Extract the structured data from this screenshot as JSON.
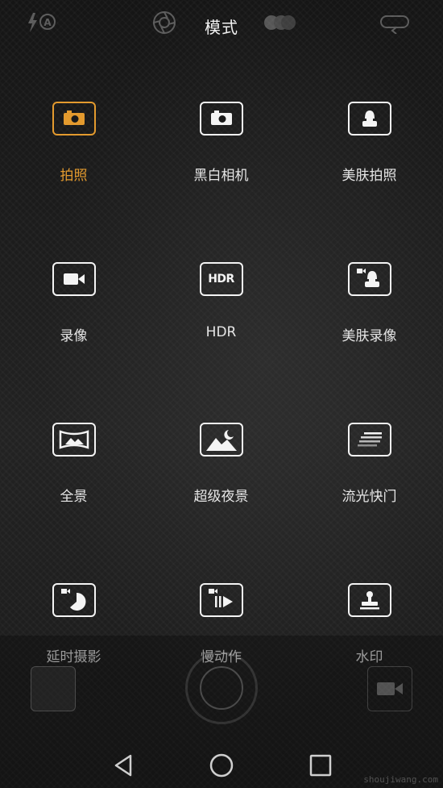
{
  "header": {
    "title": "模式"
  },
  "modes": [
    {
      "label": "拍照",
      "icon": "camera-icon",
      "active": true
    },
    {
      "label": "黑白相机",
      "icon": "camera-icon"
    },
    {
      "label": "美肤拍照",
      "icon": "portrait-icon"
    },
    {
      "label": "录像",
      "icon": "video-icon"
    },
    {
      "label": "HDR",
      "icon": "hdr-icon",
      "icon_text": "HDR"
    },
    {
      "label": "美肤录像",
      "icon": "portrait-video-icon"
    },
    {
      "label": "全景",
      "icon": "panorama-icon"
    },
    {
      "label": "超级夜景",
      "icon": "night-landscape-icon"
    },
    {
      "label": "流光快门",
      "icon": "light-trail-icon"
    },
    {
      "label": "延时摄影",
      "icon": "timelapse-icon"
    },
    {
      "label": "慢动作",
      "icon": "slow-motion-icon"
    },
    {
      "label": "水印",
      "icon": "watermark-stamp-icon"
    }
  ],
  "colors": {
    "accent": "#e39a2e",
    "icon": "#f4f4f4",
    "label": "#e6e6e6"
  },
  "watermark_text": "shoujiwang.com"
}
